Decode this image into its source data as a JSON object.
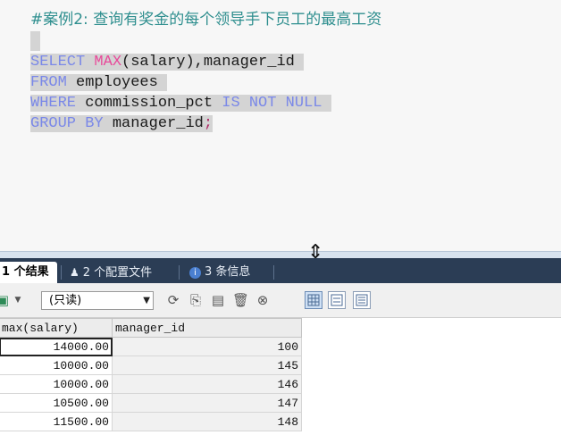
{
  "editor": {
    "comment": "#案例2: 查询有奖金的每个领导手下员工的最高工资",
    "line1": {
      "kw": "SELECT",
      "fn": "MAX",
      "rest": "(salary),manager_id"
    },
    "line2": {
      "kw": "FROM",
      "rest": "employees"
    },
    "line3": {
      "kw1": "WHERE",
      "mid": "commission_pct",
      "kw2": "IS NOT NULL"
    },
    "line4": {
      "kw": "GROUP BY",
      "rest": "manager_id",
      "end": ";"
    }
  },
  "tabs": [
    {
      "label": "1 个结果",
      "icon": "grid-icon",
      "active": true
    },
    {
      "label": "2 个配置文件",
      "icon": "profile-icon",
      "active": false
    },
    {
      "label": "3 条信息",
      "icon": "info-icon",
      "active": false
    }
  ],
  "toolbar": {
    "mode_value": "(只读)",
    "icons": [
      "export-icon",
      "dropdown-arrow-icon",
      "refresh-icon",
      "copy-icon",
      "save-icon",
      "delete-icon",
      "cancel-icon",
      "grid-view-icon",
      "form-view-icon",
      "text-view-icon"
    ]
  },
  "result": {
    "columns": [
      "max(salary)",
      "manager_id"
    ],
    "rows": [
      [
        "14000.00",
        "100"
      ],
      [
        "10000.00",
        "145"
      ],
      [
        "10000.00",
        "146"
      ],
      [
        "10500.00",
        "147"
      ],
      [
        "11500.00",
        "148"
      ]
    ]
  },
  "colors": {
    "keyword": "#7a88e8",
    "function": "#e84a9a",
    "comment": "#2f8f8f",
    "tabbar": "#2b3d55"
  }
}
